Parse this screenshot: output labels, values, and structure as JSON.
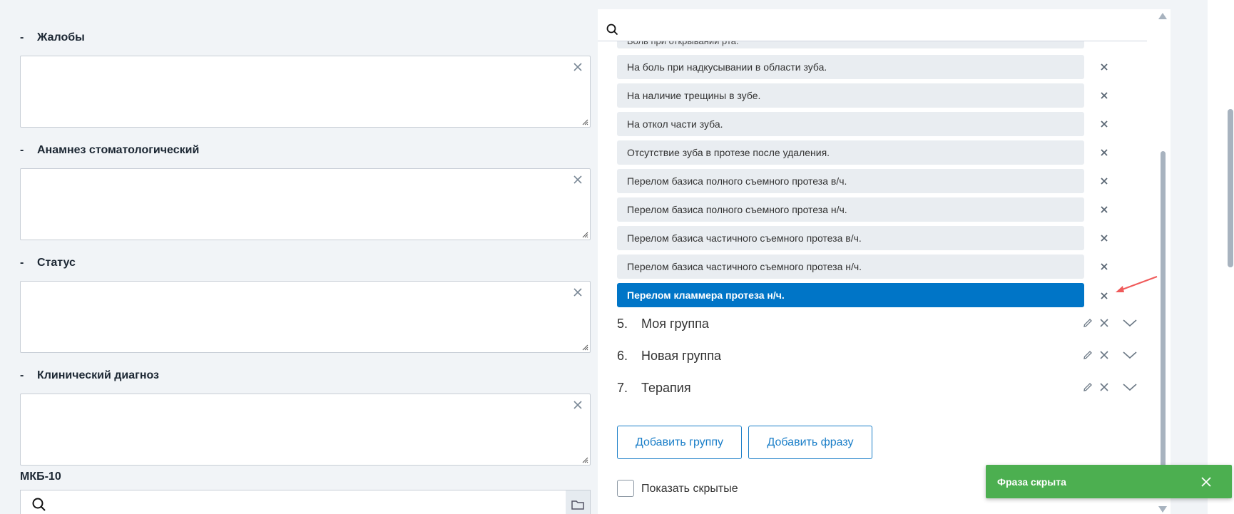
{
  "form": {
    "sections": [
      {
        "title": "Жалобы",
        "dash": "-"
      },
      {
        "title": "Анамнез стоматологический",
        "dash": "-"
      },
      {
        "title": "Статус",
        "dash": "-"
      },
      {
        "title": "Клинический диагноз",
        "dash": "-"
      }
    ],
    "mkb_label": "МКБ-10"
  },
  "panel": {
    "peek_phrase": "Боль при открывании рта.",
    "phrases": [
      {
        "text": "На боль при надкусывании в области зуба.",
        "active": false
      },
      {
        "text": "На наличие трещины в зубе.",
        "active": false
      },
      {
        "text": "На откол части зуба.",
        "active": false
      },
      {
        "text": "Отсутствие зуба в протезе после удаления.",
        "active": false
      },
      {
        "text": "Перелом базиса полного съемного протеза в/ч.",
        "active": false
      },
      {
        "text": "Перелом базиса полного съемного протеза н/ч.",
        "active": false
      },
      {
        "text": "Перелом базиса частичного съемного протеза в/ч.",
        "active": false
      },
      {
        "text": "Перелом базиса частичного съемного протеза н/ч.",
        "active": false
      },
      {
        "text": "Перелом кламмера протеза н/ч.",
        "active": true
      }
    ],
    "groups": [
      {
        "num": "5.",
        "name": "Моя группа"
      },
      {
        "num": "6.",
        "name": "Новая группа"
      },
      {
        "num": "7.",
        "name": "Терапия"
      }
    ],
    "add_group_label": "Добавить группу",
    "add_phrase_label": "Добавить фразу",
    "show_hidden_label": "Показать скрытые"
  },
  "toast": {
    "message": "Фраза скрыта",
    "color": "#4caf50"
  },
  "colors": {
    "accent": "#0075c7",
    "outline": "#1a7ec8"
  }
}
